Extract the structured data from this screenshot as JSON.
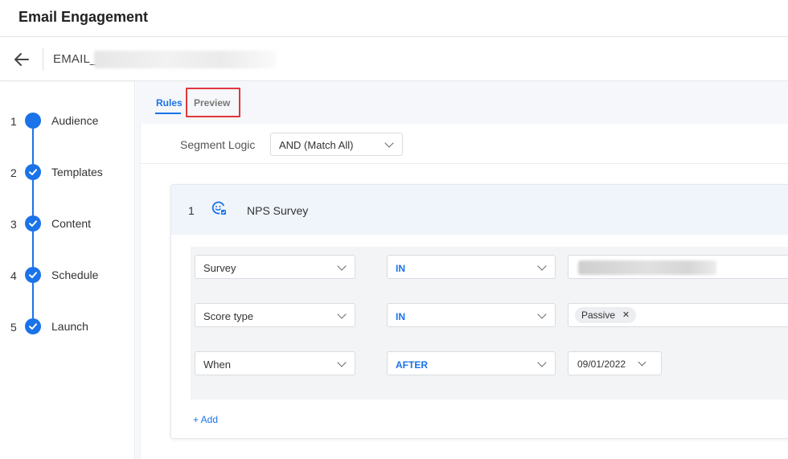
{
  "app": {
    "title": "Email Engagement"
  },
  "subheader": {
    "email_name": "EMAIL_"
  },
  "steps": [
    {
      "num": "1",
      "label": "Audience",
      "state": "current"
    },
    {
      "num": "2",
      "label": "Templates",
      "state": "done"
    },
    {
      "num": "3",
      "label": "Content",
      "state": "done"
    },
    {
      "num": "4",
      "label": "Schedule",
      "state": "done"
    },
    {
      "num": "5",
      "label": "Launch",
      "state": "done"
    }
  ],
  "tabs": {
    "rules": "Rules",
    "preview": "Preview",
    "active": "Rules"
  },
  "segment_logic": {
    "label": "Segment Logic",
    "value": "AND (Match All)"
  },
  "rule_card": {
    "index": "1",
    "icon": "nps-survey-icon",
    "title": "NPS Survey",
    "conditions": [
      {
        "field": "Survey",
        "operator": "IN",
        "value": ""
      },
      {
        "field": "Score type",
        "operator": "IN",
        "value_chip": "Passive"
      },
      {
        "field": "When",
        "operator": "AFTER",
        "date": "09/01/2022"
      }
    ],
    "add_label": "+ Add"
  },
  "colors": {
    "accent": "#1a73e8",
    "highlight": "#e0383e",
    "card_head_bg": "#f0f5fb"
  }
}
